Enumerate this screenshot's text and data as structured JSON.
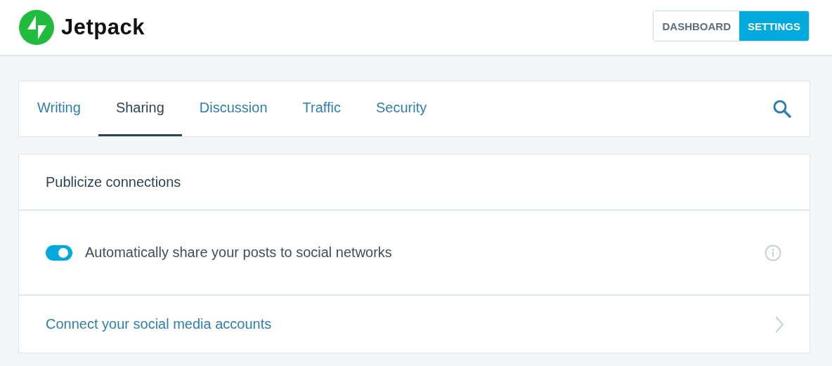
{
  "header": {
    "logo_text": "Jetpack",
    "nav": [
      {
        "label": "DASHBOARD",
        "selected": false
      },
      {
        "label": "SETTINGS",
        "selected": true
      }
    ]
  },
  "tabs": [
    {
      "label": "Writing",
      "selected": false
    },
    {
      "label": "Sharing",
      "selected": true
    },
    {
      "label": "Discussion",
      "selected": false
    },
    {
      "label": "Traffic",
      "selected": false
    },
    {
      "label": "Security",
      "selected": false
    }
  ],
  "section": {
    "title": "Publicize connections",
    "setting": {
      "label": "Automatically share your posts to social networks",
      "on": true
    },
    "link": "Connect your social media accounts"
  }
}
